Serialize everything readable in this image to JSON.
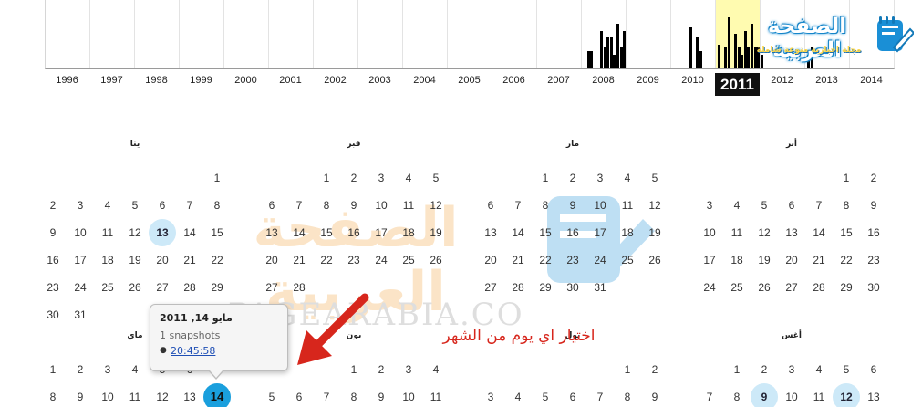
{
  "timeline": {
    "years": [
      "1996",
      "1997",
      "1998",
      "1999",
      "2000",
      "2001",
      "2002",
      "2003",
      "2004",
      "2005",
      "2006",
      "2007",
      "2008",
      "2009",
      "2010",
      "2011",
      "2012",
      "2013",
      "2014"
    ],
    "selected_year": "2011",
    "snapshot_activity": {
      "2008": [
        0,
        0.25,
        0.25,
        0,
        0,
        0.55,
        0.3,
        0.45,
        0.45,
        0.2,
        0.65,
        0.3,
        0.55
      ],
      "2009": [],
      "2010": [
        0,
        0,
        0,
        0,
        0,
        0.6,
        0,
        0.45,
        0.25
      ],
      "2011": [
        0.35,
        0,
        0.3,
        0.75,
        0,
        0.5,
        0.3,
        0.2,
        0.55,
        0.3,
        0.65,
        0.3,
        0.3,
        0.2
      ],
      "2012": [],
      "2013": [
        0.2,
        0.3
      ],
      "2014": []
    },
    "colors": {
      "highlight": "#fffbb0",
      "bar": "#000000"
    }
  },
  "logo": {
    "title": "الصفحة العربية",
    "tagline": "مجلة اخبارية منوعة شاملة",
    "icon": "notebook-pen-icon",
    "colors": {
      "primary": "#1a8fd6",
      "accent": "#ffd84a"
    }
  },
  "calendar": {
    "months": [
      {
        "title": "ينا",
        "rows": [
          [
            "",
            "",
            "",
            "",
            "",
            "",
            "1"
          ],
          [
            "2",
            "3",
            "4",
            "5",
            "6",
            "7",
            "8"
          ],
          [
            "9",
            "10",
            "11",
            "12",
            "13",
            "14",
            "15"
          ],
          [
            "16",
            "17",
            "18",
            "19",
            "20",
            "21",
            "22"
          ],
          [
            "23",
            "24",
            "25",
            "26",
            "27",
            "28",
            "29"
          ],
          [
            "30",
            "31",
            "",
            "",
            "",
            "",
            ""
          ]
        ],
        "snapshot_days": [
          "13"
        ]
      },
      {
        "title": "فبر",
        "rows": [
          [
            "",
            "",
            "1",
            "2",
            "3",
            "4",
            "5"
          ],
          [
            "6",
            "7",
            "8",
            "9",
            "10",
            "11",
            "12"
          ],
          [
            "13",
            "14",
            "15",
            "16",
            "17",
            "18",
            "19"
          ],
          [
            "20",
            "21",
            "22",
            "23",
            "24",
            "25",
            "26"
          ],
          [
            "27",
            "28",
            "",
            "",
            "",
            "",
            ""
          ]
        ],
        "snapshot_days": []
      },
      {
        "title": "مار",
        "rows": [
          [
            "",
            "",
            "1",
            "2",
            "3",
            "4",
            "5"
          ],
          [
            "6",
            "7",
            "8",
            "9",
            "10",
            "11",
            "12"
          ],
          [
            "13",
            "14",
            "15",
            "16",
            "17",
            "18",
            "19"
          ],
          [
            "20",
            "21",
            "22",
            "23",
            "24",
            "25",
            "26"
          ],
          [
            "27",
            "28",
            "29",
            "30",
            "31",
            "",
            ""
          ]
        ],
        "snapshot_days": []
      },
      {
        "title": "أبر",
        "rows": [
          [
            "",
            "",
            "",
            "",
            "",
            "1",
            "2"
          ],
          [
            "3",
            "4",
            "5",
            "6",
            "7",
            "8",
            "9"
          ],
          [
            "10",
            "11",
            "12",
            "13",
            "14",
            "15",
            "16"
          ],
          [
            "17",
            "18",
            "19",
            "20",
            "21",
            "22",
            "23"
          ],
          [
            "24",
            "25",
            "26",
            "27",
            "28",
            "29",
            "30"
          ]
        ],
        "snapshot_days": []
      },
      {
        "title": "ماي",
        "rows": [
          [
            "1",
            "2",
            "3",
            "4",
            "5",
            "6",
            "7"
          ],
          [
            "8",
            "9",
            "10",
            "11",
            "12",
            "13",
            "14"
          ]
        ],
        "snapshot_days": [],
        "selected_day": "14"
      },
      {
        "title": "يون",
        "rows": [
          [
            "",
            "",
            "",
            "1",
            "2",
            "3",
            "4"
          ],
          [
            "5",
            "6",
            "7",
            "8",
            "9",
            "10",
            "11"
          ]
        ],
        "snapshot_days": []
      },
      {
        "title": "يول",
        "rows": [
          [
            "",
            "",
            "",
            "",
            "",
            "1",
            "2"
          ],
          [
            "3",
            "4",
            "5",
            "6",
            "7",
            "8",
            "9"
          ]
        ],
        "snapshot_days": []
      },
      {
        "title": "أغس",
        "rows": [
          [
            "",
            "1",
            "2",
            "3",
            "4",
            "5",
            "6"
          ],
          [
            "7",
            "8",
            "9",
            "10",
            "11",
            "12",
            "13"
          ]
        ],
        "snapshot_days": [
          "9",
          "12"
        ]
      }
    ],
    "colors": {
      "snapshot_day": "#cde9f8",
      "selected_day": "#1a9fdd"
    }
  },
  "popup": {
    "date": "مايو 14, 2011",
    "count": "1 snapshots",
    "time": "20:45:58"
  },
  "watermark": {
    "arabic": "الصفحة العربية",
    "url": "PAGEARABIA.CO",
    "icon": "notebook-pen-icon"
  },
  "annotation": {
    "text": "اختيار اي يوم من الشهر",
    "color": "#d7261c",
    "arrow": "red-arrow-icon"
  }
}
